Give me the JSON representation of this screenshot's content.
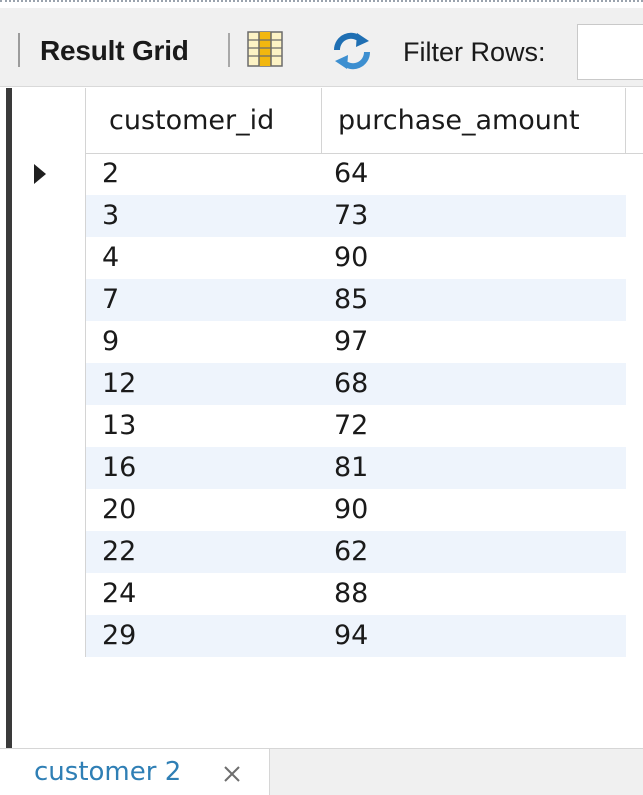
{
  "toolbar": {
    "result_grid_label": "Result Grid",
    "filter_rows_label": "Filter Rows:",
    "filter_value": "",
    "icons": [
      "grid-form-icon",
      "refresh-icon"
    ]
  },
  "grid": {
    "columns": [
      "customer_id",
      "purchase_amount"
    ],
    "rows": [
      {
        "customer_id": "2",
        "purchase_amount": "64"
      },
      {
        "customer_id": "3",
        "purchase_amount": "73"
      },
      {
        "customer_id": "4",
        "purchase_amount": "90"
      },
      {
        "customer_id": "7",
        "purchase_amount": "85"
      },
      {
        "customer_id": "9",
        "purchase_amount": "97"
      },
      {
        "customer_id": "12",
        "purchase_amount": "68"
      },
      {
        "customer_id": "13",
        "purchase_amount": "72"
      },
      {
        "customer_id": "16",
        "purchase_amount": "81"
      },
      {
        "customer_id": "20",
        "purchase_amount": "90"
      },
      {
        "customer_id": "22",
        "purchase_amount": "62"
      },
      {
        "customer_id": "24",
        "purchase_amount": "88"
      },
      {
        "customer_id": "29",
        "purchase_amount": "94"
      }
    ],
    "selected_row": 0
  },
  "tab": {
    "label": "customer 2",
    "close_icon": "close-icon"
  },
  "colors": {
    "alt_row": "#eef4fc",
    "tab_label": "#2f7fb5",
    "refresh_blue": "#1f6fb3"
  }
}
